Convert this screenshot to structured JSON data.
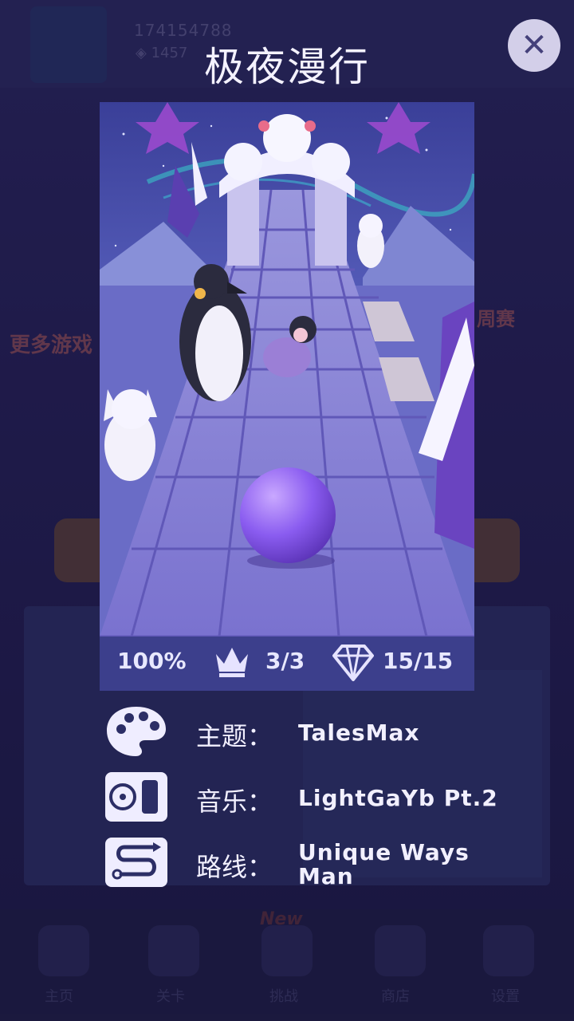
{
  "background": {
    "score": "174154788",
    "gems": "1457",
    "more_games": "更多游戏",
    "weekly": "周赛",
    "new_badge": "New",
    "nav": [
      "主页",
      "关卡",
      "挑战",
      "商店",
      "设置"
    ]
  },
  "modal": {
    "title": "极夜漫行",
    "close_icon": "close-icon",
    "stats": {
      "progress": "100%",
      "crowns": "3/3",
      "gems": "15/15"
    },
    "info": [
      {
        "icon": "palette-icon",
        "label": "主题：",
        "value": "TalesMax"
      },
      {
        "icon": "music-player-icon",
        "label": "音乐：",
        "value": "LightGaYb Pt.2"
      },
      {
        "icon": "route-icon",
        "label": "路线：",
        "value": "Unique Ways Man"
      }
    ]
  },
  "colors": {
    "accent": "#8a5cf0",
    "tile": "#8b86d6",
    "panel": "#3c3f8c"
  }
}
